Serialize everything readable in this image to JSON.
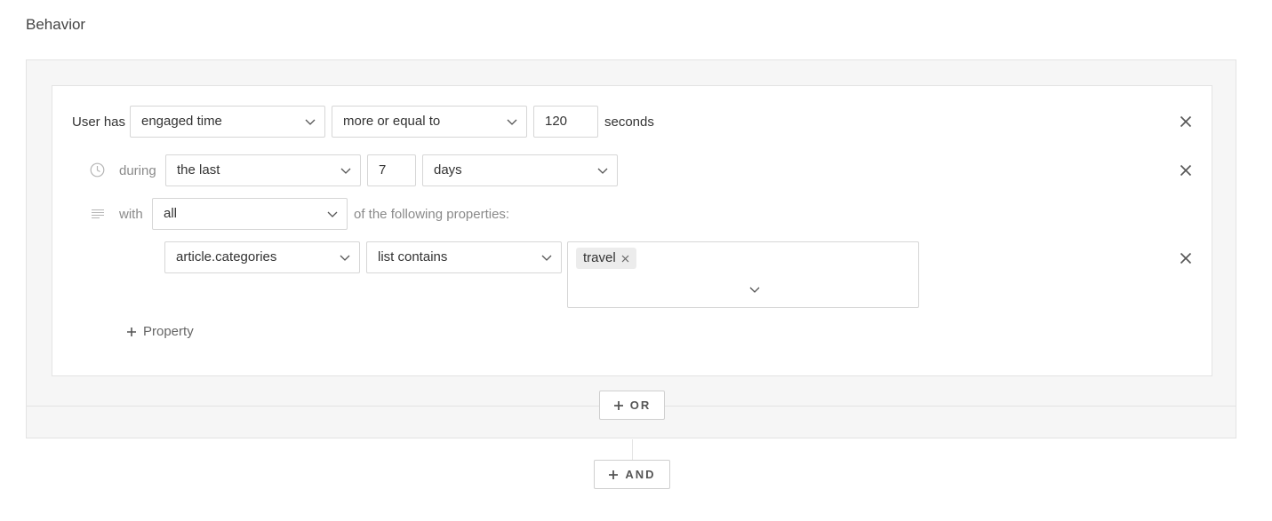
{
  "section": {
    "title": "Behavior"
  },
  "condition": {
    "prefix": "User has",
    "metric": "engaged time",
    "operator": "more or equal to",
    "amount": "120",
    "unit": "seconds"
  },
  "timeframe": {
    "label": "during",
    "range": "the last",
    "amount": "7",
    "unit": "days"
  },
  "properties": {
    "label": "with",
    "quantifier": "all",
    "suffix": "of the following properties:",
    "rows": [
      {
        "property": "article.categories",
        "operator": "list contains",
        "values": [
          "travel"
        ]
      }
    ],
    "add_label": "Property"
  },
  "buttons": {
    "or_label": "OR",
    "and_label": "AND"
  },
  "icons": {
    "clock": "clock-icon",
    "lines": "lines-icon",
    "close": "close-icon",
    "chevron": "chevron-down-icon",
    "plus": "plus-icon"
  },
  "colors": {
    "border": "#d6d6d6",
    "panel_bg": "#f6f6f6",
    "chip_bg": "#ececec",
    "muted_text": "#8a8a8a"
  }
}
